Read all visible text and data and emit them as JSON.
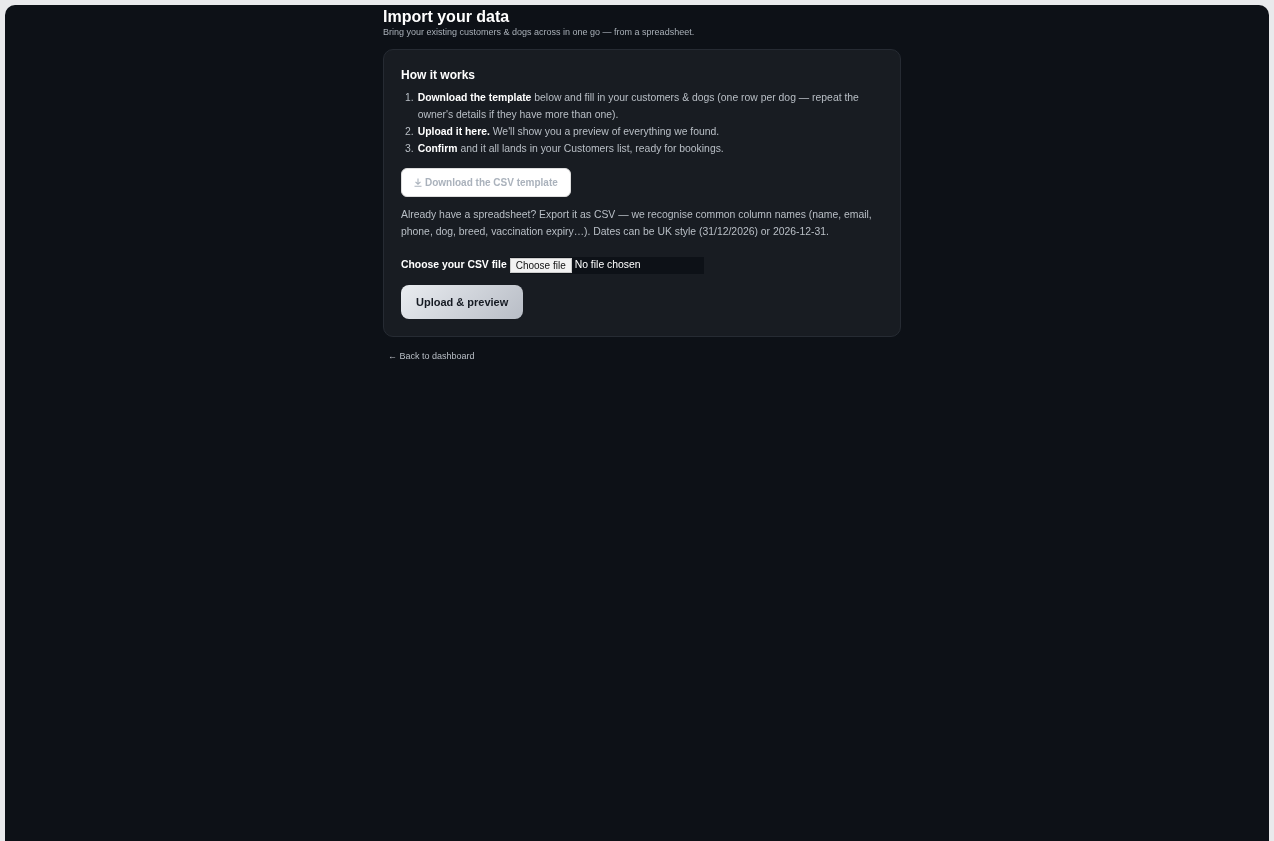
{
  "header": {
    "title": "Import your data",
    "subtitle": "Bring your existing customers & dogs across in one go — from a spreadsheet."
  },
  "card": {
    "heading": "How it works",
    "steps": [
      {
        "number": "1.",
        "text": "**Download the template** below and fill in your customers & dogs (one row per dog — repeat the owner's details if they have more than one)."
      },
      {
        "number": "2.",
        "text": "**Upload it here.** We'll show you a preview of everything we found."
      },
      {
        "number": "3.",
        "text": "**Confirm** and it all lands in your Customers list, ready for bookings."
      }
    ],
    "download_button": {
      "label": "Download the CSV template",
      "disabled": true
    },
    "note": "Already have a spreadsheet? Export it as CSV — we recognise common column names (name, email, phone, dog, breed, vaccination expiry…). Dates can be UK style (31/12/2026) or 2026-12-31.",
    "file_input": {
      "label": "Choose your CSV file",
      "button": "Choose file",
      "status": "No file chosen"
    },
    "submit_button": {
      "label": "Upload & preview"
    }
  },
  "back_link": {
    "label": "← Back to dashboard"
  }
}
